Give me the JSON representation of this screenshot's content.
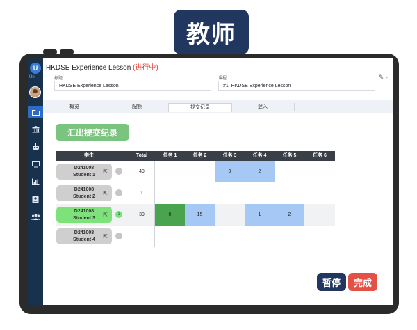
{
  "badge": "教师",
  "header": {
    "title": "HKDSE Experience Lesson",
    "status": "(进行中)",
    "title_label": "标题",
    "title_value": "HKDSE Experience Lesson",
    "course_label": "课程",
    "course_value": "#1. HKDSE Experience Lesson"
  },
  "sidebar": {
    "logo": "U",
    "logo_text": "Uni"
  },
  "tabs": [
    "概览",
    "配额",
    "提交记录",
    "登入"
  ],
  "active_tab": 2,
  "export_label": "汇出提交纪录",
  "table": {
    "headers": [
      "学生",
      "Total",
      "任务 1",
      "任务 2",
      "任务 3",
      "任务 4",
      "任务 5",
      "任务 6"
    ],
    "rows": [
      {
        "id": "D241008",
        "name": "Student 1",
        "badge": "",
        "total": "49",
        "tasks": [
          "",
          "",
          "9",
          "2",
          "",
          ""
        ]
      },
      {
        "id": "D241008",
        "name": "Student 2",
        "badge": "",
        "total": "1",
        "tasks": [
          "",
          "",
          "",
          "",
          "",
          ""
        ]
      },
      {
        "id": "D241008",
        "name": "Student 3",
        "badge": "1",
        "total": "39",
        "tasks": [
          "0",
          "15",
          "",
          "1",
          "2",
          ""
        ]
      },
      {
        "id": "D241008",
        "name": "Student 4",
        "badge": "",
        "total": "",
        "tasks": [
          "",
          "",
          "",
          "",
          "",
          ""
        ]
      }
    ]
  },
  "buttons": {
    "pause": "暂停",
    "finish": "完成"
  },
  "colors": {
    "blue_cell": "#a6c8f5",
    "green_cell": "#4aa34d",
    "accent": "#22375f",
    "danger": "#e45046"
  }
}
